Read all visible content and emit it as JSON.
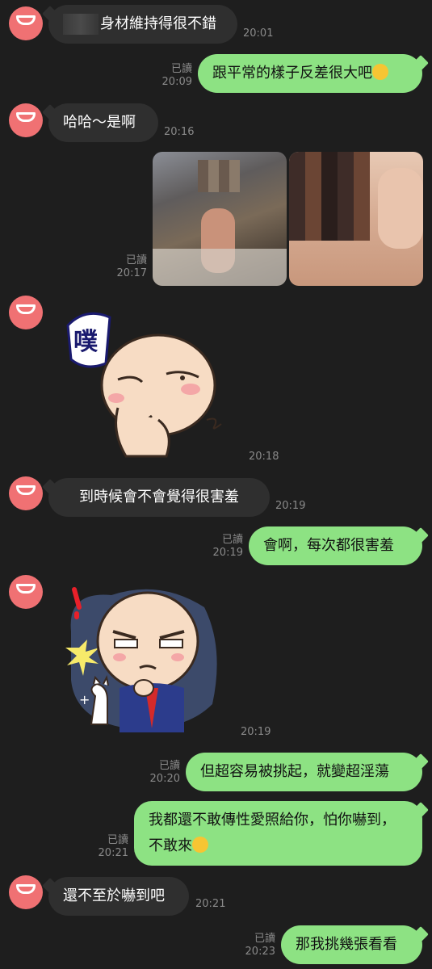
{
  "messages": [
    {
      "id": "m1",
      "side": "in",
      "text": "身材維持得很不錯",
      "time": "20:01"
    },
    {
      "id": "m2",
      "side": "out",
      "text": "跟平常的樣子反差很大吧",
      "emoji": "rolling-on-floor-laughing-emoji",
      "read": "已讀",
      "time": "20:09"
    },
    {
      "id": "m3",
      "side": "in",
      "text": "哈哈～是啊",
      "time": "20:16"
    },
    {
      "id": "m4",
      "side": "out",
      "type": "photos",
      "photos": [
        "photo-1 (blurred)",
        "photo-2 (blurred)"
      ],
      "read": "已讀",
      "time": "20:17"
    },
    {
      "id": "m5",
      "side": "in",
      "type": "sticker",
      "sticker_text": "噗",
      "time": "20:18"
    },
    {
      "id": "m6",
      "side": "in",
      "text": "到時候會不會覺得很害羞",
      "time": "20:19"
    },
    {
      "id": "m7",
      "side": "out",
      "text": "會啊，每次都很害羞",
      "read": "已讀",
      "time": "20:19"
    },
    {
      "id": "m8",
      "side": "in",
      "type": "sticker",
      "time": "20:19"
    },
    {
      "id": "m9",
      "side": "out",
      "text": "但超容易被挑起，就變超淫蕩",
      "read": "已讀",
      "time": "20:20"
    },
    {
      "id": "m10",
      "side": "out",
      "text": "我都還不敢傳性愛照給你，怕你嚇到，不敢來",
      "emoji": "pleading-face-emoji",
      "read": "已讀",
      "time": "20:21"
    },
    {
      "id": "m11",
      "side": "in",
      "text": "還不至於嚇到吧",
      "time": "20:21"
    },
    {
      "id": "m12",
      "side": "out",
      "text": "那我挑幾張看看",
      "read": "已讀",
      "time": "20:23"
    }
  ],
  "colors": {
    "background": "#1e1e1e",
    "incoming_bubble": "#2f2f2f",
    "outgoing_bubble": "#8de283",
    "avatar": "#f07173",
    "meta_text": "#8a8a8a"
  }
}
